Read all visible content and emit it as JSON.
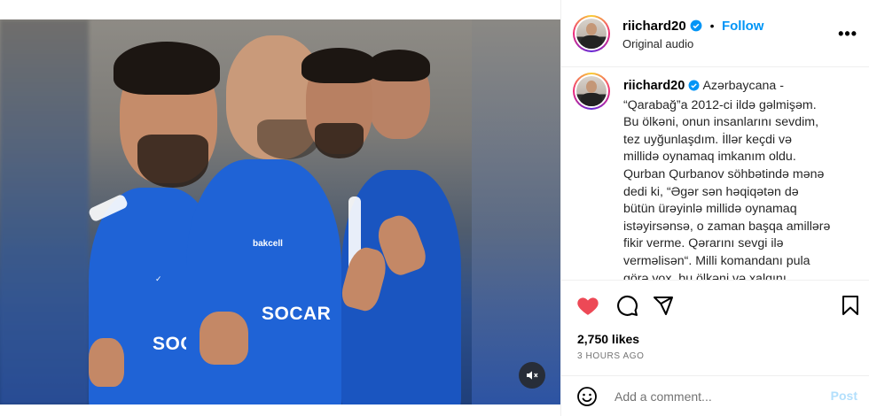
{
  "post": {
    "username": "riichard20",
    "verified": true,
    "separator": "•",
    "follow_label": "Follow",
    "audio": "Original audio",
    "more_label": "•••",
    "caption_lines": [
      "Azərbaycana -",
      "“Qarabağ”a 2012-ci ildə gəlmişəm.",
      "Bu ölkəni, onun insanlarını sevdim,",
      "tez uyğunlaşdım. İllər keçdi və",
      "millidə oynamaq imkanım oldu.",
      "Qurban Qurbanov söhbətində mənə",
      "dedi ki, “Əgər sən həqiqətən də",
      "bütün ürəyinlə millidə oynamaq",
      "istəyirsənsə, o zaman başqa amillərə",
      "fikir verme. Qərarını sevgi ilə",
      "verməlisən“. Milli komandanı pula",
      "görə yox, bu ölkəni və xalqını"
    ],
    "likes": "2,750 likes",
    "time": "3 HOURS AGO",
    "liked": true
  },
  "media": {
    "sponsor_main": "SOCAR",
    "sponsor_left": "SOC",
    "shirt_brand": "bakcell",
    "muted": true
  },
  "comment": {
    "placeholder": "Add a comment...",
    "post_label": "Post"
  },
  "icons": {
    "like": "heart-icon",
    "comment": "comment-icon",
    "share": "paper-plane-icon",
    "save": "bookmark-icon",
    "emoji": "emoji-icon",
    "mute": "speaker-muted-icon",
    "verified": "verified-badge-icon",
    "more": "more-options-icon"
  },
  "colors": {
    "like": "#ed4956",
    "follow": "#0095f6",
    "post_disabled": "#b2dffc",
    "jersey": "#1f63d6"
  }
}
